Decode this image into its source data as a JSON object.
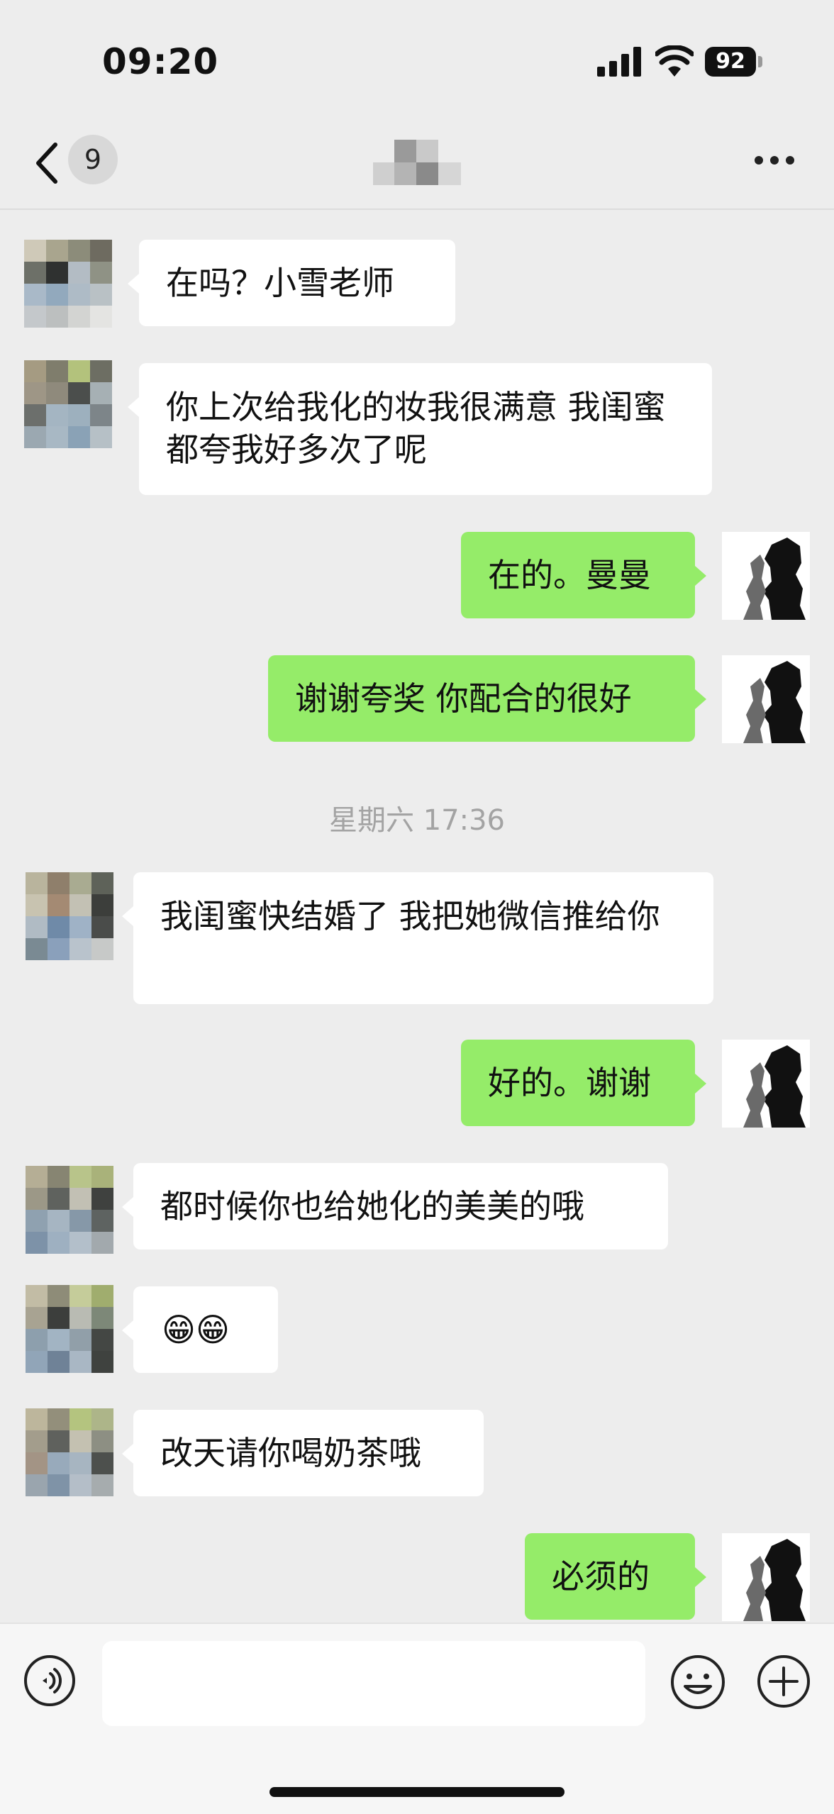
{
  "status_bar": {
    "time": "09:20",
    "battery": "92"
  },
  "nav": {
    "unread_count": "9",
    "title": ""
  },
  "timestamp": "星期六 17:36",
  "messages": [
    {
      "side": "left",
      "text": "在吗？小雪老师"
    },
    {
      "side": "left",
      "text": "你上次给我化的妆我很满意 我闺蜜都夸我好多次了呢"
    },
    {
      "side": "right",
      "text": "在的。曼曼"
    },
    {
      "side": "right",
      "text": "谢谢夸奖 你配合的很好"
    },
    {
      "side": "left",
      "text": "我闺蜜快结婚了 我把她微信推给你"
    },
    {
      "side": "right",
      "text": "好的。谢谢"
    },
    {
      "side": "left",
      "text": "都时候你也给她化的美美的哦"
    },
    {
      "side": "left",
      "text": "😁😁"
    },
    {
      "side": "left",
      "text": "改天请你喝奶茶哦"
    },
    {
      "side": "right",
      "text": "必须的"
    }
  ],
  "input": {
    "value": "",
    "placeholder": ""
  },
  "colors": {
    "background": "#ededed",
    "my_bubble": "#95ec69",
    "their_bubble": "#ffffff",
    "timestamp": "#a3a3a3"
  },
  "icons": [
    "back-icon",
    "more-icon",
    "voice-icon",
    "emoji-icon",
    "plus-icon",
    "signal-icon",
    "wifi-icon",
    "battery-icon"
  ]
}
